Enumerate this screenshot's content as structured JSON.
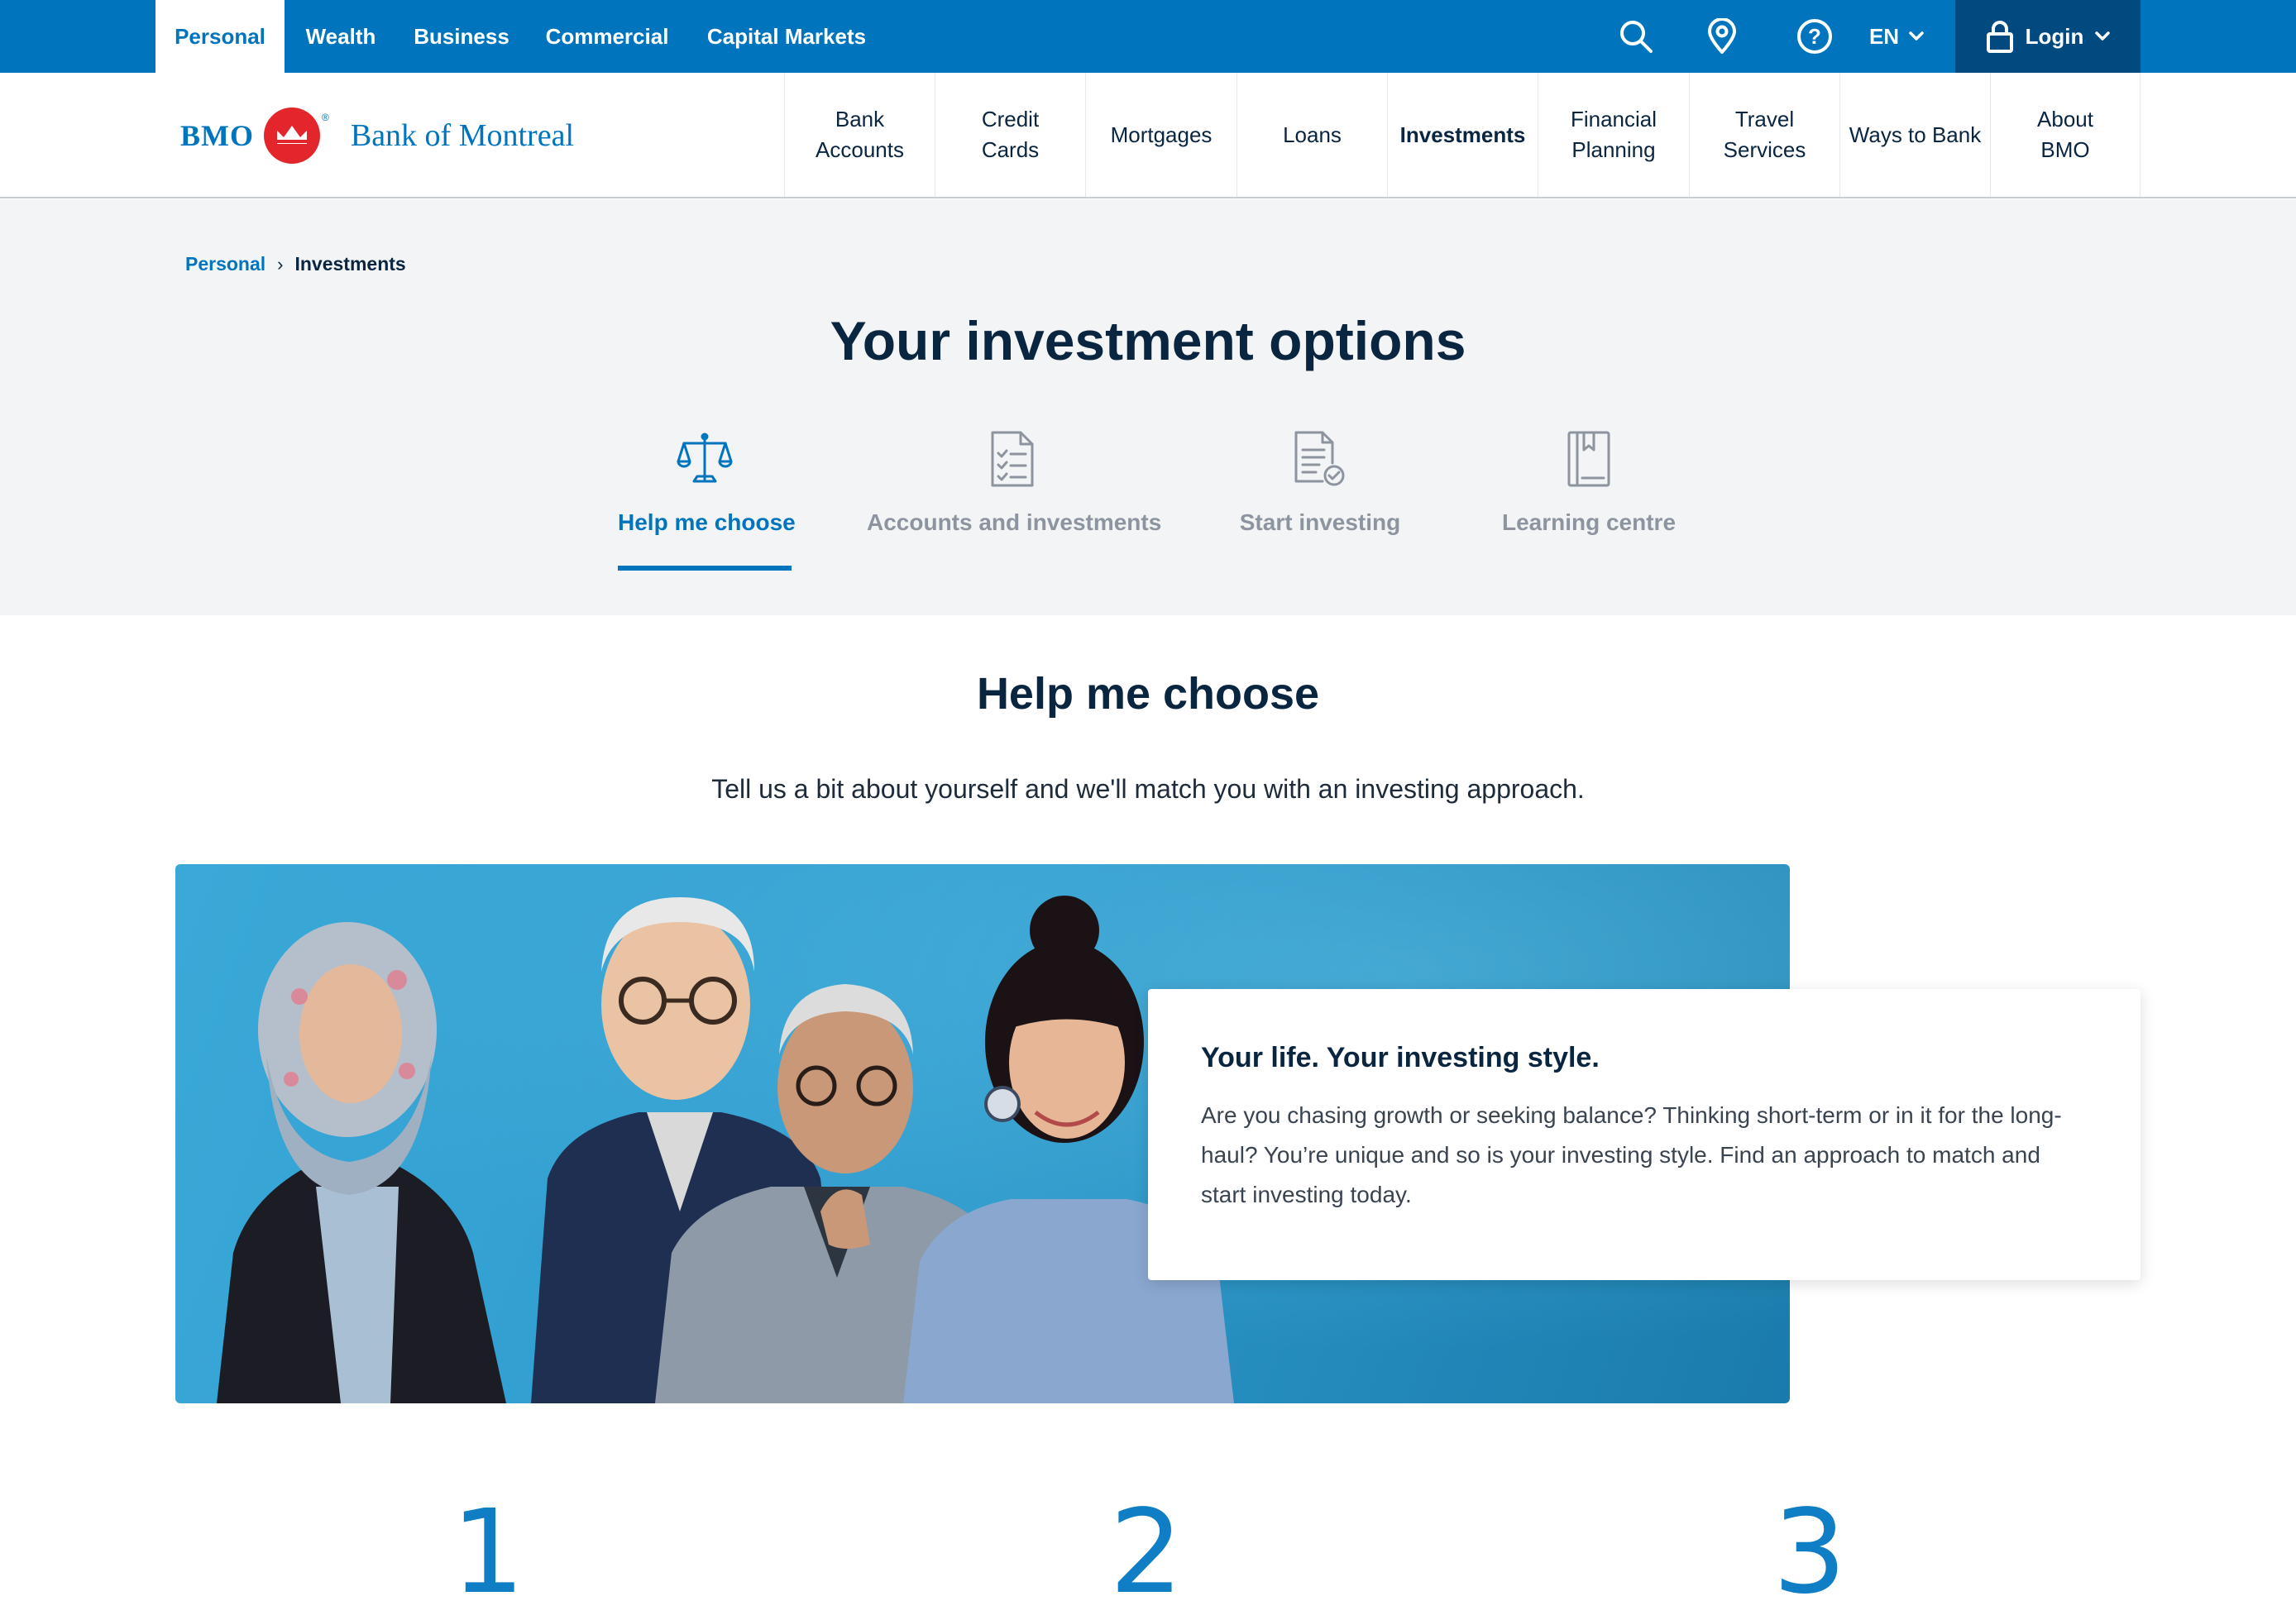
{
  "topbar": {
    "segments": [
      "Personal",
      "Wealth",
      "Business",
      "Commercial",
      "Capital Markets"
    ],
    "icons": [
      "search-icon",
      "location-pin-icon",
      "help-icon"
    ],
    "lang": "EN",
    "login": "Login"
  },
  "logo": {
    "bmo": "BMO",
    "bank_name": "Bank of Montreal"
  },
  "nav": {
    "items": [
      "Bank Accounts",
      "Credit Cards",
      "Mortgages",
      "Loans",
      "Investments",
      "Financial Planning",
      "Travel Services",
      "Ways to Bank",
      "About BMO"
    ],
    "active": "Investments"
  },
  "breadcrumb": {
    "parent": "Personal",
    "current": "Investments"
  },
  "hero": {
    "title": "Your investment options",
    "tabs": [
      {
        "label": "Help me choose",
        "icon": "scales-icon",
        "active": true
      },
      {
        "label": "Accounts and investments",
        "icon": "checklist-document-icon",
        "active": false
      },
      {
        "label": "Start investing",
        "icon": "document-check-icon",
        "active": false
      },
      {
        "label": "Learning centre",
        "icon": "book-icon",
        "active": false
      }
    ]
  },
  "section": {
    "title": "Help me choose",
    "subtitle": "Tell us a bit about yourself and we'll match you with an investing approach."
  },
  "card": {
    "title": "Your life. Your investing style.",
    "body": "Are you chasing growth or seeking balance? Thinking short-term or in it for the long-haul? You’re unique and so is your investing style. Find an approach to match and start investing today."
  },
  "steps": [
    "1",
    "2",
    "3"
  ],
  "colors": {
    "brand_blue": "#0075be",
    "dark_blue": "#004a80",
    "navy_text": "#0a2540",
    "bmo_red": "#e3262b",
    "grey_bg": "#f3f4f6"
  }
}
